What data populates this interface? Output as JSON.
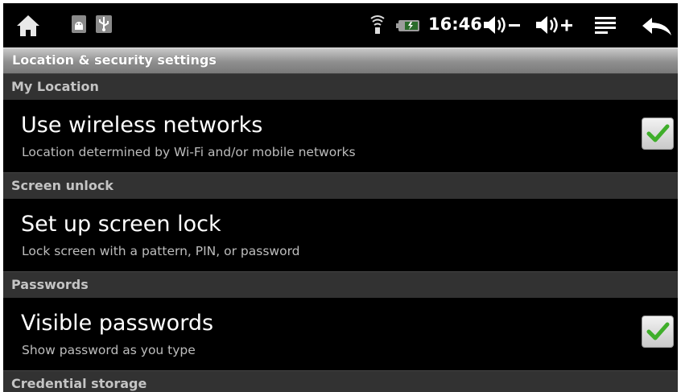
{
  "statusbar": {
    "clock": "16:46",
    "icons": [
      "home-icon",
      "android-debug-icon",
      "usb-icon",
      "wifi-icon",
      "battery-icon",
      "volume-down-icon",
      "volume-up-icon",
      "menu-icon",
      "back-icon"
    ]
  },
  "title": "Location & security settings",
  "sections": [
    {
      "header": "My Location",
      "item": {
        "title": "Use wireless networks",
        "summary": "Location determined by Wi-Fi and/or mobile networks",
        "checked": true
      }
    },
    {
      "header": "Screen unlock",
      "item": {
        "title": "Set up screen lock",
        "summary": "Lock screen with a pattern, PIN, or password",
        "checked": null
      }
    },
    {
      "header": "Passwords",
      "item": {
        "title": "Visible passwords",
        "summary": "Show password as you type",
        "checked": true
      }
    },
    {
      "header": "Credential storage"
    }
  ],
  "colors": {
    "checkmark": "#3fae2a",
    "section_bg": "#323232",
    "title_bar": "#9a9a9a"
  }
}
